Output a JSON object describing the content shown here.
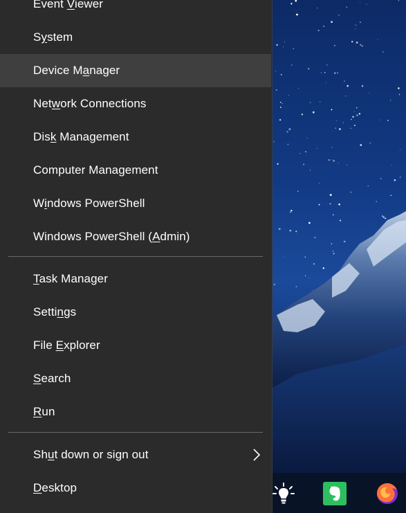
{
  "menu": {
    "items_top": [
      {
        "pre": "Event ",
        "key": "V",
        "post": "iewer"
      },
      {
        "pre": "S",
        "key": "y",
        "post": "stem"
      },
      {
        "pre": "Device M",
        "key": "a",
        "post": "nager"
      },
      {
        "pre": "Net",
        "key": "w",
        "post": "ork Connections"
      },
      {
        "pre": "Dis",
        "key": "k",
        "post": " Management"
      },
      {
        "pre": "Computer Mana",
        "key": "g",
        "post": "ement"
      },
      {
        "pre": "W",
        "key": "i",
        "post": "ndows PowerShell"
      },
      {
        "pre": "Windows PowerShell (",
        "key": "A",
        "post": "dmin)"
      }
    ],
    "items_mid": [
      {
        "pre": "",
        "key": "T",
        "post": "ask Manager"
      },
      {
        "pre": "Setti",
        "key": "n",
        "post": "gs"
      },
      {
        "pre": "File ",
        "key": "E",
        "post": "xplorer"
      },
      {
        "pre": "",
        "key": "S",
        "post": "earch"
      },
      {
        "pre": "",
        "key": "R",
        "post": "un"
      }
    ],
    "items_bottom": [
      {
        "pre": "Sh",
        "key": "u",
        "post": "t down or sign out"
      },
      {
        "pre": "",
        "key": "D",
        "post": "esktop"
      }
    ],
    "highlighted": "Device Manager"
  },
  "taskbar": {
    "icons": [
      "lightbulb-icon",
      "evernote-icon",
      "firefox-icon"
    ]
  },
  "colors": {
    "menu_bg": "#2b2b2b",
    "menu_hover": "#3f3f3f",
    "separator": "#6a6a6a",
    "evernote": "#2dbe60",
    "firefox": "#ff7139"
  }
}
